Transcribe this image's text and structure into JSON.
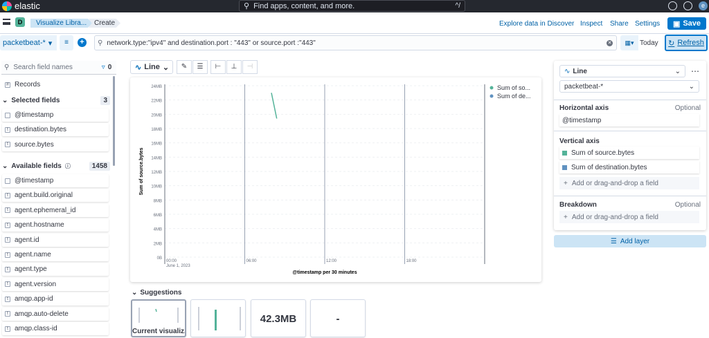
{
  "topbar": {
    "brand": "elastic",
    "search_placeholder": "Find apps, content, and more.",
    "search_shortcut": "^/",
    "avatar_letter": "e"
  },
  "appbar": {
    "space_letter": "D",
    "breadcrumbs": [
      "Visualize Libra...",
      "Create"
    ],
    "links": [
      "Explore data in Discover",
      "Inspect",
      "Share",
      "Settings"
    ],
    "save_label": "Save"
  },
  "querybar": {
    "index_pattern": "packetbeat-*",
    "query": "network.type:\"ipv4\" and destination.port : \"443\" or source.port :\"443\"",
    "date_label": "Today",
    "refresh_label": "Refresh"
  },
  "fields": {
    "search_placeholder": "Search field names",
    "filter_count": "0",
    "records_label": "Records",
    "selected_label": "Selected fields",
    "selected_count": "3",
    "selected": [
      "@timestamp",
      "destination.bytes",
      "source.bytes"
    ],
    "available_label": "Available fields",
    "available_count": "1458",
    "available": [
      "@timestamp",
      "agent.build.original",
      "agent.ephemeral_id",
      "agent.hostname",
      "agent.id",
      "agent.name",
      "agent.type",
      "agent.version",
      "amqp.app-id",
      "amqp.auto-delete",
      "amqp.class-id"
    ]
  },
  "toolbar": {
    "chart_type": "Line"
  },
  "chart_data": {
    "type": "line",
    "ylabel": "Sum of source.bytes",
    "xlabel": "@timestamp per 30 minutes",
    "y_ticks": [
      "24MB",
      "22MB",
      "20MB",
      "18MB",
      "16MB",
      "14MB",
      "12MB",
      "10MB",
      "8MB",
      "6MB",
      "4MB",
      "2MB",
      "0B"
    ],
    "x_ticks": [
      "00:00",
      "06:00",
      "12:00",
      "18:00"
    ],
    "x_date_label": "June 1, 2023",
    "ylim": [
      0,
      24
    ],
    "series": [
      {
        "name": "Sum of so...",
        "color": "#54b399",
        "points": [
          [
            8.0,
            23.0
          ],
          [
            8.4,
            19.4
          ]
        ]
      },
      {
        "name": "Sum of de...",
        "color": "#6092c0",
        "points": []
      }
    ],
    "legend": "top-right",
    "grid": true
  },
  "suggestions": {
    "title": "Suggestions",
    "items": [
      "Current visualiz...",
      "",
      "42.3MB",
      "-"
    ]
  },
  "config": {
    "chart_type": "Line",
    "index_pattern": "packetbeat-*",
    "horizontal_label": "Horizontal axis",
    "horizontal_optional": "Optional",
    "horizontal_field": "@timestamp",
    "vertical_label": "Vertical axis",
    "vertical_fields": [
      {
        "name": "Sum of source.bytes",
        "color": "#54b399"
      },
      {
        "name": "Sum of destination.bytes",
        "color": "#6092c0"
      }
    ],
    "add_field": "Add or drag-and-drop a field",
    "breakdown_label": "Breakdown",
    "breakdown_optional": "Optional",
    "add_layer": "Add layer"
  }
}
